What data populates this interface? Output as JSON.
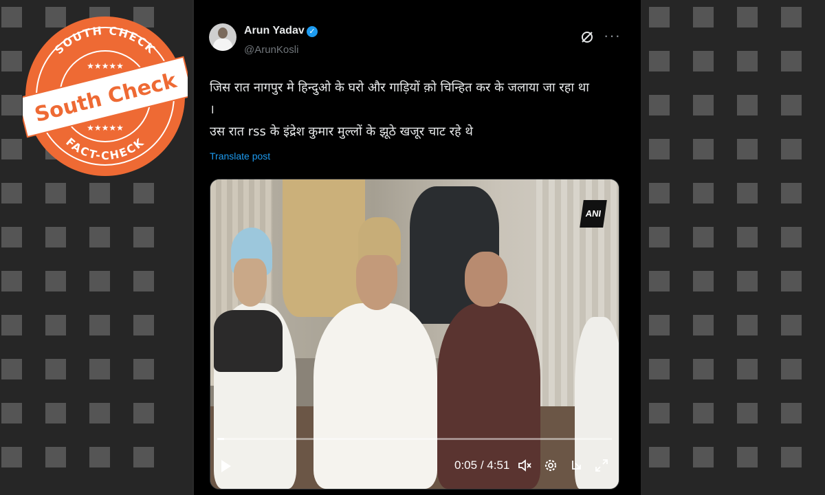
{
  "stamp": {
    "top_text": "SOUTH CHECK",
    "bottom_text": "FACT-CHECK",
    "logo_text": "South Check",
    "ring_color": "#ee6a34",
    "banner_color": "#ffffff"
  },
  "tweet": {
    "author_name": "Arun Yadav",
    "handle": "@ArunKosli",
    "verified": true,
    "text_lines": [
      "जिस रात नागपुर मे हिन्दुओ के घरो  और  गाड़ियों क़ो चिन्हित कर के जलाया जा रहा था",
      "।",
      "उस रात rss के इंद्रेश कुमार मुल्लों के झूठे  खजूर चाट रहे थे"
    ],
    "translate_label": "Translate post",
    "accent_color": "#1d9bf0"
  },
  "video": {
    "watermark": "ANI",
    "current_time": "0:05",
    "separator": "/",
    "duration": "4:51",
    "progress_fraction": 0.018,
    "controls": [
      "play-icon",
      "volume-muted-icon",
      "settings-gear-icon",
      "pip-icon",
      "fullscreen-icon"
    ]
  }
}
